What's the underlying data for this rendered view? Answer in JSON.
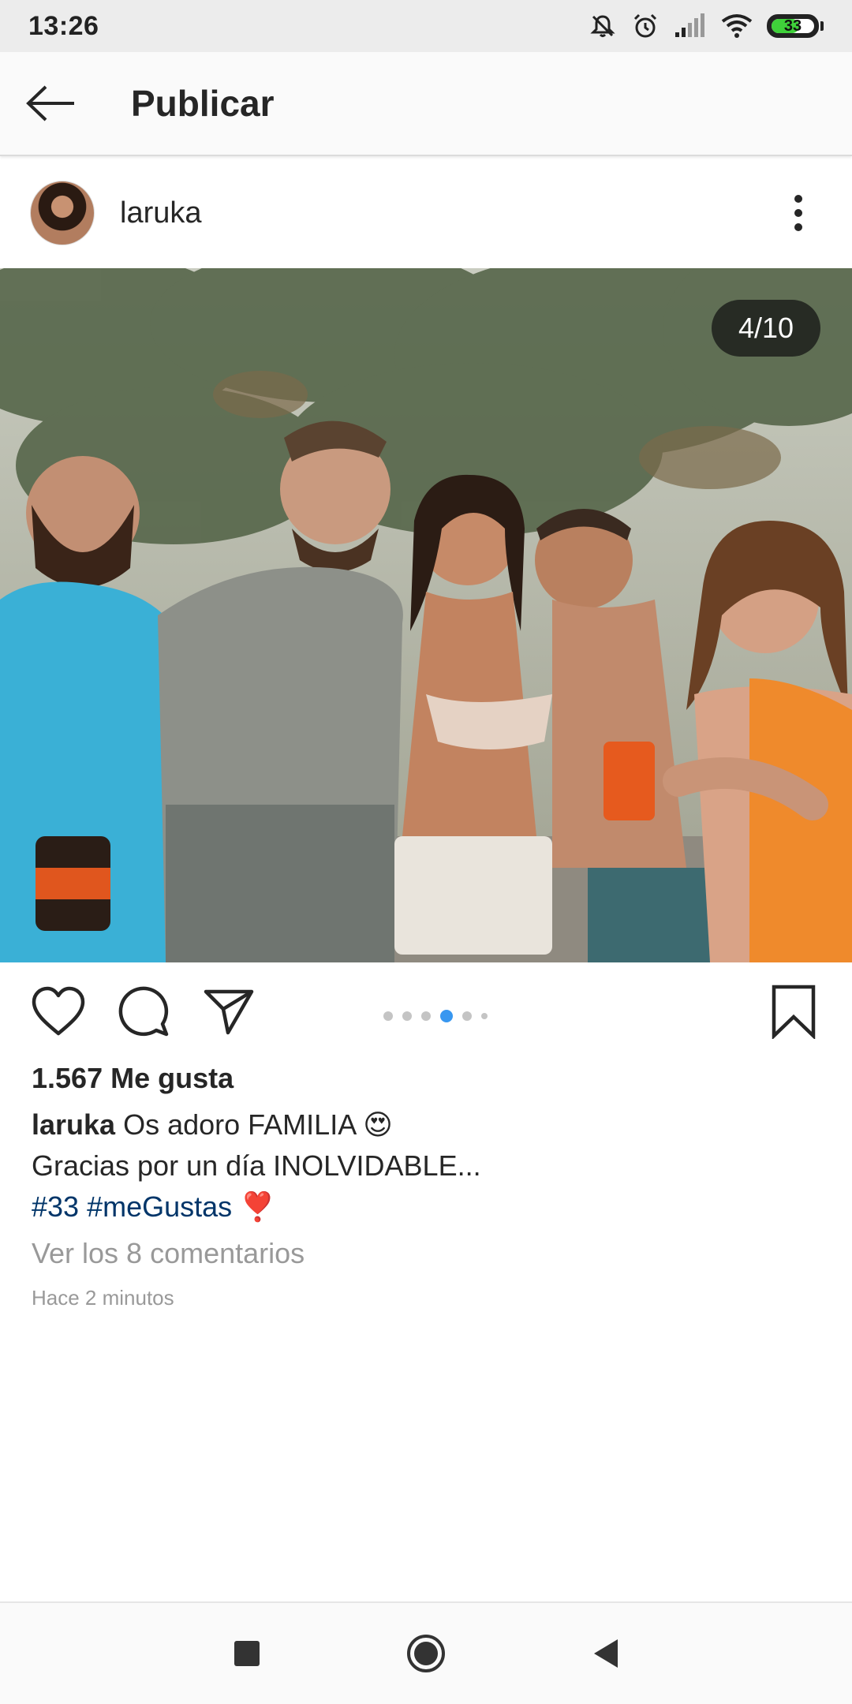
{
  "status_bar": {
    "time": "13:26",
    "battery_level": "33",
    "icons": [
      "mute-icon",
      "alarm-icon",
      "signal-icon",
      "wifi-icon",
      "battery-icon"
    ],
    "battery_color": "#3fd13a"
  },
  "app_bar": {
    "title": "Publicar",
    "back_icon": "back-arrow-icon"
  },
  "post": {
    "username": "laruka",
    "avatar_icon": "avatar",
    "more_icon": "more-vertical-icon",
    "carousel_counter": "4/10",
    "carousel_current": 4,
    "carousel_total": 10,
    "actions": {
      "like_icon": "heart-icon",
      "comment_icon": "comment-icon",
      "share_icon": "send-icon",
      "save_icon": "bookmark-icon"
    },
    "likes": "1.567 Me gusta",
    "caption": {
      "username": "laruka",
      "line1": " Os adoro FAMILIA 😍",
      "line2": "Gracias por un día INOLVIDABLE...",
      "hashtag1": "#33",
      "hashtag2": "#meGustas",
      "emoji": " ❣️"
    },
    "view_comments": "Ver los 8 comentarios",
    "timestamp": "Hace 2 minutos"
  },
  "nav_bar": {
    "items": [
      "recents-square-icon",
      "home-circle-icon",
      "back-triangle-icon"
    ]
  },
  "colors": {
    "accent_blue": "#3897f0",
    "hashtag": "#003569",
    "muted_text": "#999999"
  }
}
